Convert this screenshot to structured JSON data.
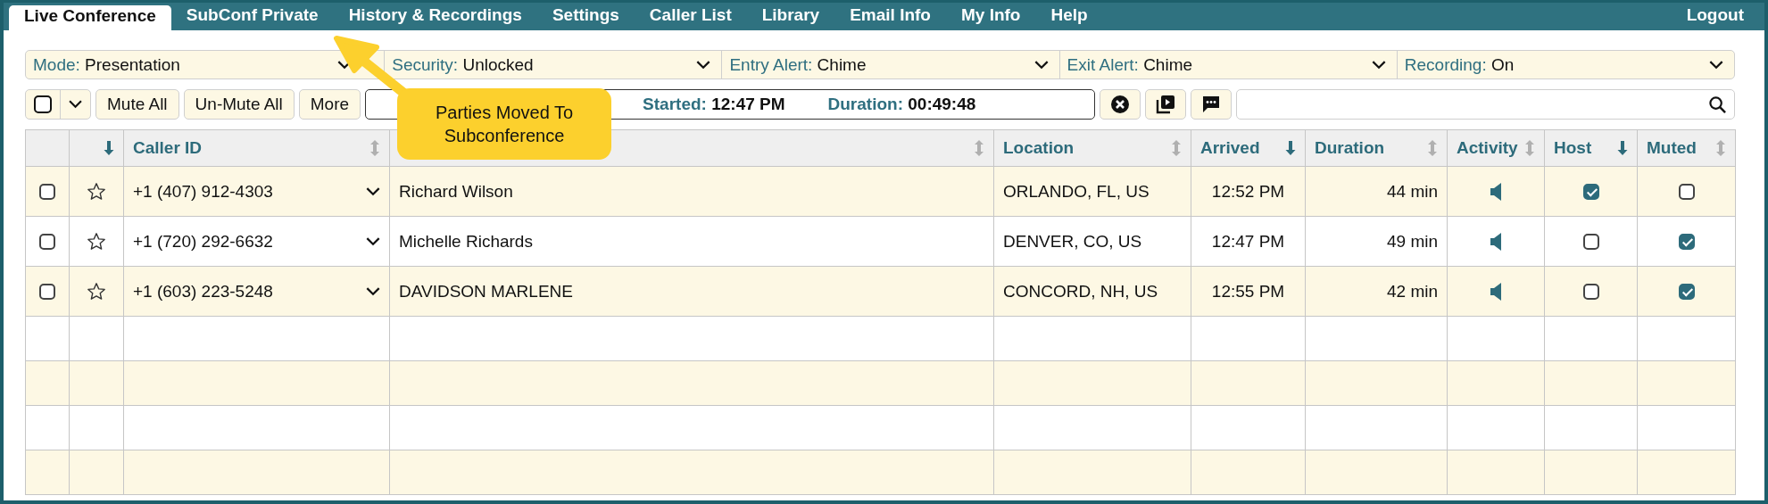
{
  "tabs": [
    {
      "label": "Live Conference",
      "selected": true
    },
    {
      "label": "SubConf Private",
      "selected": false
    },
    {
      "label": "History & Recordings",
      "selected": false
    },
    {
      "label": "Settings",
      "selected": false
    },
    {
      "label": "Caller List",
      "selected": false
    },
    {
      "label": "Library",
      "selected": false
    },
    {
      "label": "Email Info",
      "selected": false
    },
    {
      "label": "My Info",
      "selected": false
    },
    {
      "label": "Help",
      "selected": false
    }
  ],
  "logout": "Logout",
  "settings": [
    {
      "label": "Mode:",
      "value": "Presentation"
    },
    {
      "label": "Security:",
      "value": "Unlocked"
    },
    {
      "label": "Entry Alert:",
      "value": "Chime"
    },
    {
      "label": "Exit Alert:",
      "value": "Chime"
    },
    {
      "label": "Recording:",
      "value": "On"
    }
  ],
  "toolbar": {
    "select_all": {
      "checked": false
    },
    "buttons": [
      "Mute All",
      "Un-Mute All",
      "More"
    ],
    "started": {
      "label": "Started:",
      "value": "12:47 PM"
    },
    "duration": {
      "label": "Duration:",
      "value": "00:49:48"
    }
  },
  "table": {
    "columns": [
      {},
      {
        "sorted": true
      },
      {
        "label": "Caller ID",
        "sorted": false
      },
      {
        "sorted": false
      },
      {
        "label": "Location",
        "sorted": false
      },
      {
        "label": "Arrived",
        "sorted": true
      },
      {
        "label": "Duration",
        "sorted": false
      },
      {
        "label": "Activity",
        "sorted": false
      },
      {
        "label": "Host",
        "sorted": true
      },
      {
        "label": "Muted",
        "sorted": false
      }
    ],
    "rows": [
      {
        "selected": false,
        "starred": false,
        "caller_id": "+1 (407) 912-4303",
        "name": "Richard Wilson",
        "location": "ORLANDO, FL, US",
        "arrived": "12:52 PM",
        "duration": "44 min",
        "host": true,
        "muted": false
      },
      {
        "selected": false,
        "starred": false,
        "caller_id": "+1 (720) 292-6632",
        "name": "Michelle Richards",
        "location": "DENVER, CO, US",
        "arrived": "12:47 PM",
        "duration": "49 min",
        "host": false,
        "muted": true
      },
      {
        "selected": false,
        "starred": false,
        "caller_id": "+1 (603) 223-5248",
        "name": "DAVIDSON MARLENE",
        "location": "CONCORD, NH, US",
        "arrived": "12:55 PM",
        "duration": "42 min",
        "host": false,
        "muted": true
      }
    ]
  },
  "callout": {
    "text": "Parties Moved To Subconference"
  }
}
